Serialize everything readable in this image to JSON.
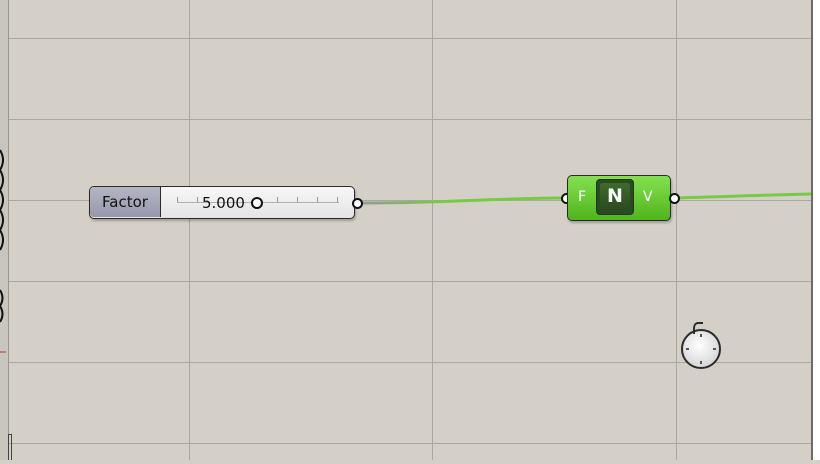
{
  "slider": {
    "label": "Factor",
    "value": "5.000",
    "fraction": 0.48
  },
  "component": {
    "input_label": "F",
    "icon_glyph": "N",
    "output_label": "V",
    "color": "#6cd23b"
  },
  "canvas": {
    "background": "#d4d0c8",
    "grid_color": "#a9a6a0",
    "wire_color": "#7ac943"
  },
  "icons": {
    "component_icon": "unit-vector-icon",
    "navigation": "rotate-control-icon"
  }
}
